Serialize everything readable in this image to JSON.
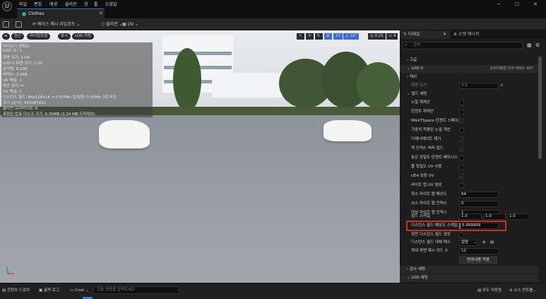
{
  "app": {
    "logo": "U",
    "tab_title": "Clothes"
  },
  "menu": [
    "파일",
    "편집",
    "에셋",
    "클리관",
    "창",
    "툴",
    "도움말"
  ],
  "window_controls": {
    "minimize": "─",
    "maximize": "☐",
    "close": "✕"
  },
  "toolbar": {
    "base_mesh_label": "베이스 메시 리임포트",
    "clear_label": "클리전",
    "uv_label": "UV"
  },
  "viewport": {
    "buttons": [
      "원근",
      "라이팅포함",
      "표시",
      "LOD 자동"
    ],
    "grid_value": "10",
    "angle_value": "10°",
    "scale_value": "0.25",
    "camera_value": "4",
    "stats": [
      "미리보기 정확도:",
      "LOD: 0 / 1",
      "화면 크기: 1.09",
      "LOD 0 화면 크기: 1.00",
      "삼각형: 6,136",
      "버텍스: 3,068",
      "UV 채널: 1",
      "최근 감지: 4",
      "UV 채널: 1",
      "디스턴스 필드: 84x126x14 = 0.07Mb (압축됨) 0.00Mb 스트리밍",
      "크기 (순서): 425x87x61",
      "콜리전 프리미티브: 0",
      "측정된 압축 디스크 크기: 0.35MB (3.24 MB 드라이브)"
    ]
  },
  "panel": {
    "tab_details": "디테일",
    "tab_socket": "소켓 매니저",
    "search_placeholder": "검색",
    "sections": {
      "general": "고급",
      "lod": "LOD 0",
      "mesh": "메쉬",
      "reduction": "화면 크기",
      "build": "빌드 세팅",
      "material": "감소 세팅",
      "lod_settings": "LOD 세팅"
    },
    "lod_info": "트라이앵글 576  버텍스 497",
    "screen_size_value": "2.0",
    "build_rows": [
      {
        "label": "노멀 재계산",
        "checked": false
      },
      {
        "label": "탄젠트 재계산",
        "checked": false
      },
      {
        "label": "MikkTSpace 탄젠트 스페이스",
        "checked": true
      },
      {
        "label": "가중치 적용된 노멀 계산",
        "checked": false
      },
      {
        "label": "디제너레이트 제거",
        "checked": true
      },
      {
        "label": "역 인덱스 버퍼 빌드",
        "checked": true
      },
      {
        "label": "높은 정밀도 탄젠트 베이시스",
        "checked": false
      },
      {
        "label": "풀 정밀도 UV 사용",
        "checked": false
      },
      {
        "label": "UE4 호환 UV",
        "checked": true
      },
      {
        "label": "라이트 맵 UV 생성",
        "checked": false
      }
    ],
    "min_lightmap_res_label": "최소 라이트 맵 해상도",
    "min_lightmap_res": "64",
    "src_lightmap_index_label": "소스 라이트 맵 인덱스",
    "src_lightmap_index": "0",
    "dst_lightmap_index_label": "대상 라이트 맵 인덱스",
    "dst_lightmap_index": "1",
    "build_scale_label": "빌드 스케일",
    "build_scale": [
      "1.0",
      "1.0",
      "1.0"
    ],
    "df_res_label": "디스턴스 필드 해상도 스케일",
    "df_res_value": "6.999999",
    "two_sided_df_label": "양면 디스턴스 필드 생성",
    "replacement_mesh_label": "디스턴스 필드 대체 메시",
    "replacement_mesh_value": "없음",
    "max_lumen_cards_label": "최대 루멘 메시 카드 수",
    "max_lumen_cards_value": "12",
    "apply_changes": "변경내용 적용"
  },
  "bottom": {
    "content_drawer": "콘텐츠 드로어",
    "output_log": "출력 로그",
    "cmd": "Cmd",
    "cmd_placeholder": "콘솔 명령을 입력하세요",
    "save_all": "모두 저장됨",
    "source_control": "소스 컨트롤..."
  }
}
